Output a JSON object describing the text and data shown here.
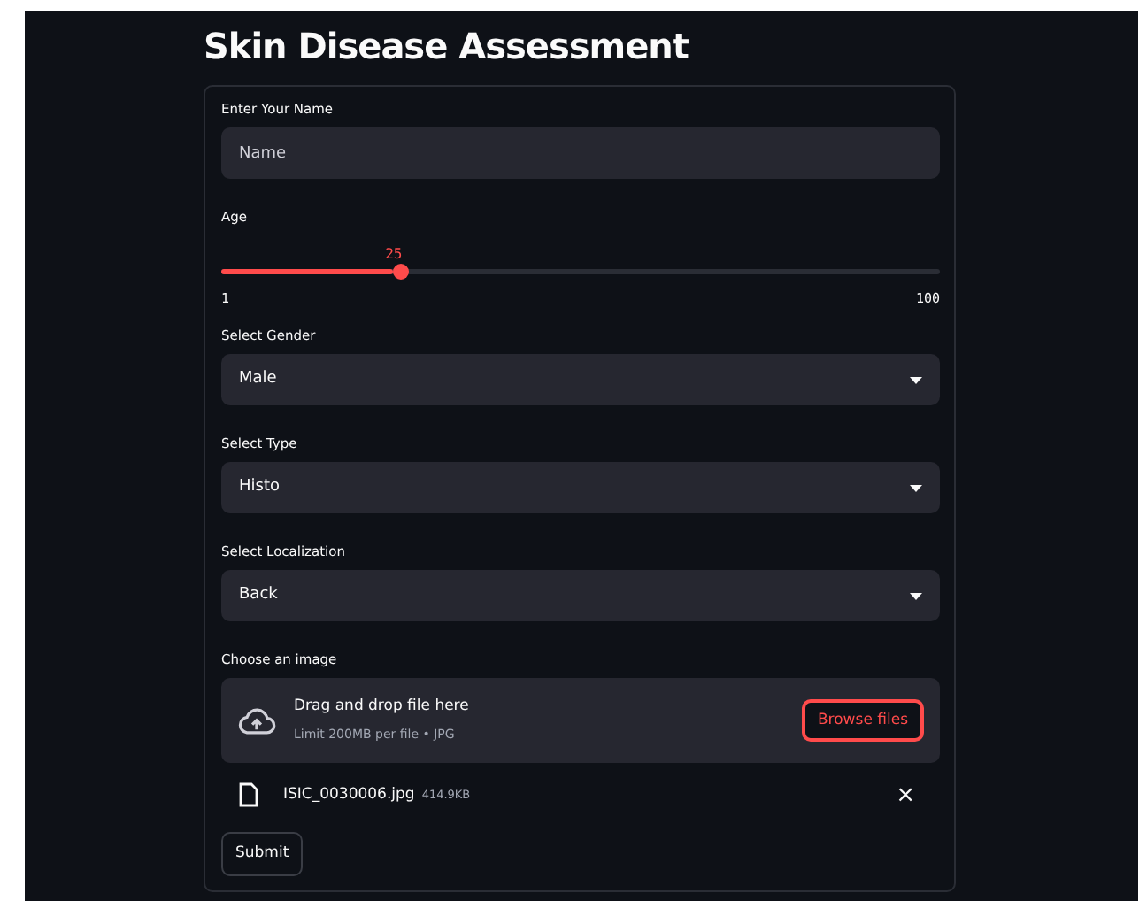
{
  "title": "Skin Disease Assessment",
  "name_field": {
    "label": "Enter Your Name",
    "placeholder": "Name"
  },
  "age_slider": {
    "label": "Age",
    "value": "25",
    "min": "1",
    "max": "100",
    "level": 0.24
  },
  "selects": [
    {
      "label": "Select Gender",
      "value": "Male"
    },
    {
      "label": "Select Type",
      "value": "Histo"
    },
    {
      "label": "Select Localization",
      "value": "Back"
    }
  ],
  "uploader": {
    "label": "Choose an image",
    "drop_text": "Drag and drop file here",
    "limit_text": "Limit 200MB per file • JPG",
    "button": "Browse files"
  },
  "file": {
    "name": "ISIC_0030006.jpg",
    "size": "414.9KB",
    "remove": "×"
  },
  "submit": "Submit"
}
